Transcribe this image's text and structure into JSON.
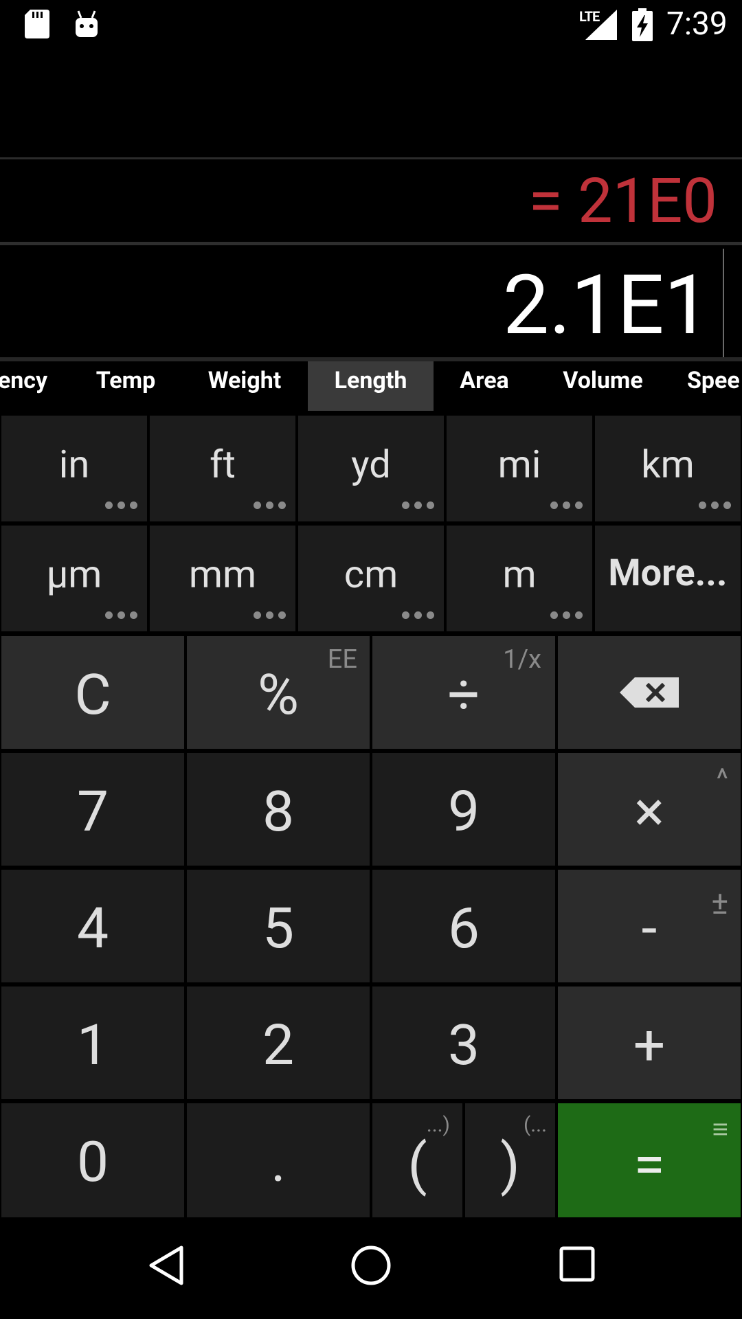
{
  "status_bar": {
    "network": "LTE",
    "time": "7:39"
  },
  "display": {
    "result": "= 21E0",
    "expression": "2.1E1"
  },
  "unit_tabs": [
    {
      "label": "ency"
    },
    {
      "label": "Temp"
    },
    {
      "label": "Weight"
    },
    {
      "label": "Length",
      "active": true
    },
    {
      "label": "Area"
    },
    {
      "label": "Volume"
    },
    {
      "label": "Spee"
    }
  ],
  "units_row1": [
    "in",
    "ft",
    "yd",
    "mi",
    "km"
  ],
  "units_row2": [
    "µm",
    "mm",
    "cm",
    "m",
    "More..."
  ],
  "keys": {
    "clear": "C",
    "percent": "%",
    "percent_sub": "EE",
    "divide": "÷",
    "divide_sub": "1/x",
    "k7": "7",
    "k8": "8",
    "k9": "9",
    "multiply": "×",
    "multiply_sub": "^",
    "k4": "4",
    "k5": "5",
    "k6": "6",
    "minus": "-",
    "minus_sub": "±",
    "k1": "1",
    "k2": "2",
    "k3": "3",
    "plus": "+",
    "k0": "0",
    "decimal": ".",
    "open_paren": "(",
    "open_paren_sub": "...)",
    "close_paren": ")",
    "close_paren_sub": "(...",
    "equals": "=",
    "equals_sub": "≡"
  },
  "colors": {
    "result": "#c0323a",
    "equals_key": "#1e6b16",
    "tab_active": "#3a3a3a"
  }
}
